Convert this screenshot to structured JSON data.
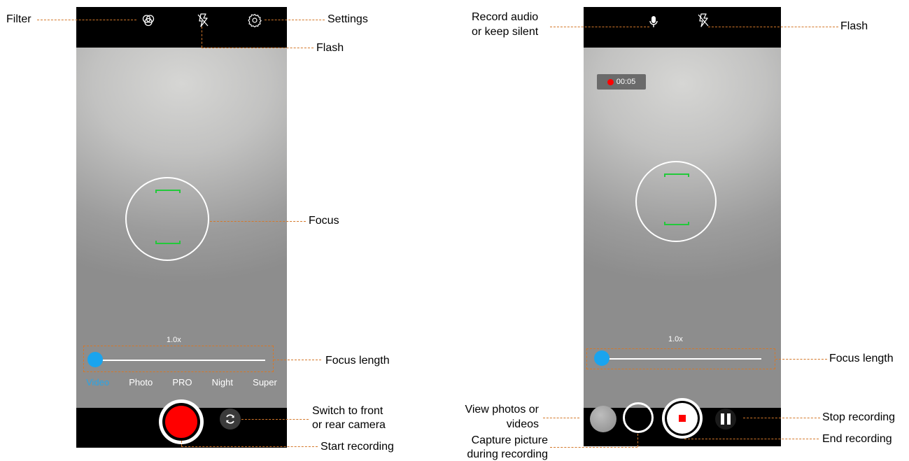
{
  "left_screen": {
    "zoom": "1.0x",
    "zoom_level_fraction": 0.0,
    "modes": [
      {
        "label": "Video",
        "active": true
      },
      {
        "label": "Photo",
        "active": false
      },
      {
        "label": "PRO",
        "active": false
      },
      {
        "label": "Night",
        "active": false
      },
      {
        "label": "Super",
        "active": false
      }
    ],
    "icons": [
      "filter-icon",
      "flash-off-icon",
      "settings-icon",
      "record-button",
      "switch-camera-icon"
    ]
  },
  "right_screen": {
    "zoom": "1.0x",
    "zoom_level_fraction": 0.0,
    "timer": "00:05",
    "icons": [
      "microphone-icon",
      "flash-off-icon",
      "gallery-thumbnail",
      "capture-button",
      "stop-button",
      "pause-icon"
    ]
  },
  "callouts": {
    "filter": "Filter",
    "settings": "Settings",
    "flash_left": "Flash",
    "focus": "Focus",
    "focus_length_left": "Focus length",
    "switch_camera_1": "Switch to front",
    "switch_camera_2": "or rear camera",
    "start_recording": "Start recording",
    "record_audio_1": "Record audio",
    "record_audio_2": "or keep silent",
    "flash_right": "Flash",
    "focus_length_right": "Focus length",
    "view_photos_1": "View photos or",
    "view_photos_2": "videos",
    "capture_1": "Capture picture",
    "capture_2": "during recording",
    "stop_recording": "Stop recording",
    "end_recording": "End recording"
  },
  "colors": {
    "accent_blue": "#1aa4ee",
    "record_red": "#ff0000",
    "focus_green": "#22c93a",
    "callout_line": "#d4782a"
  }
}
